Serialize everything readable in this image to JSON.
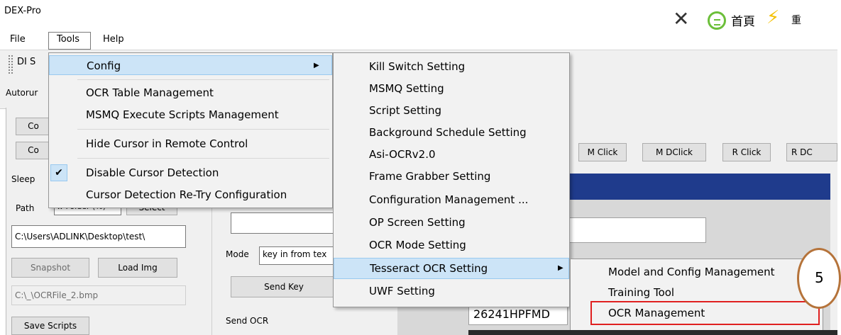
{
  "window": {
    "title": "DEX-Pro"
  },
  "topright": {
    "home_label": "首頁",
    "cut_text": "重"
  },
  "menubar": {
    "file": "File",
    "tools": "Tools",
    "help": "Help"
  },
  "toolbar": {
    "label": "DI S"
  },
  "tabs": {
    "autorun": "Autorur"
  },
  "left": {
    "btn1": "Co",
    "btn2": "Co",
    "sleep": "Sleep",
    "path": "Path",
    "path_value": "w Folder (%)",
    "select": "Select",
    "folder_value": "C:\\Users\\ADLINK\\Desktop\\test\\",
    "snapshot": "Snapshot",
    "load_img": "Load Img",
    "file_value": "C:\\_\\OCRFile_2.bmp",
    "save_scripts": "Save Scripts"
  },
  "mid": {
    "mode_label": "Mode",
    "mode_value": "key in from tex",
    "send_key": "Send Key",
    "send_ocr": "Send OCR"
  },
  "right": {
    "mclick": "M Click",
    "mdclick": "M DClick",
    "rclick": "R Click",
    "rdclick": "R DC",
    "output_value": "26241HPFMD"
  },
  "tools_menu": {
    "config": "Config",
    "ocr_table": "OCR Table Management",
    "msmq_exec": "MSMQ Execute Scripts Management",
    "hide_cursor": "Hide Cursor in Remote Control",
    "disable_cursor": "Disable Cursor Detection",
    "retry": "Cursor Detection Re-Try Configuration"
  },
  "config_menu": [
    "Kill Switch Setting",
    "MSMQ Setting",
    "Script Setting",
    "Background Schedule Setting",
    "Asi-OCRv2.0",
    "Frame Grabber Setting",
    "Configuration Management ...",
    "OP Screen Setting",
    "OCR Mode Setting",
    "Tesseract OCR Setting",
    "UWF Setting"
  ],
  "tess_menu": {
    "model": "Model and Config Management",
    "training": "Training Tool",
    "ocr_mgmt": "OCR Management"
  },
  "callout": {
    "number": "5"
  },
  "colors": {
    "highlight": "#cce4f7",
    "accent_red": "#e02020",
    "callout": "#b5733a"
  }
}
